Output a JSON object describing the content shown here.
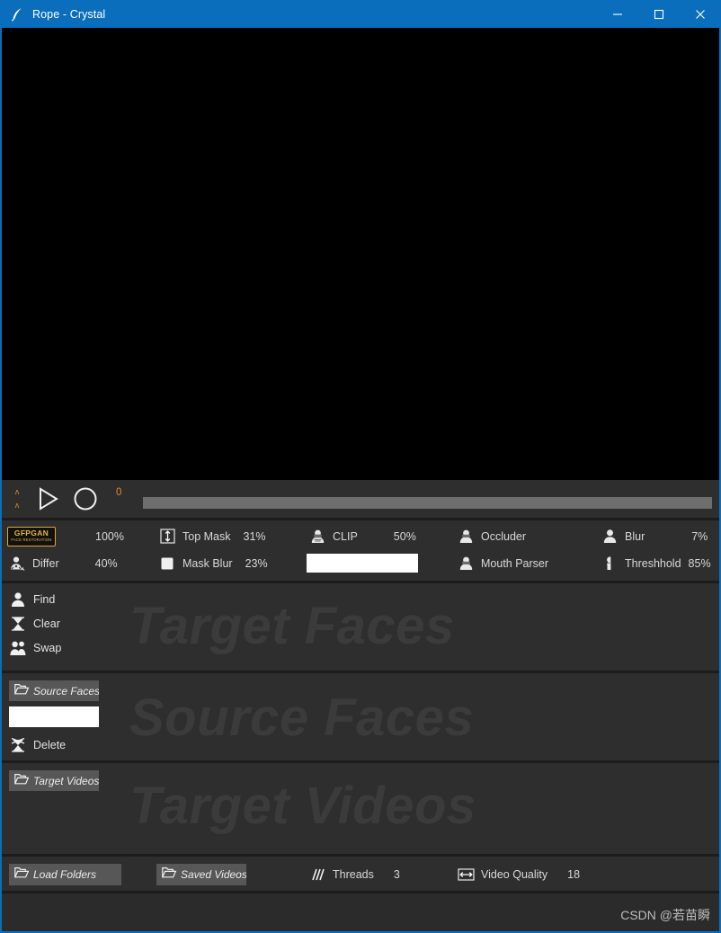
{
  "window": {
    "title": "Rope - Crystal",
    "app_icon": "feather-icon",
    "accent_color": "#0a6ebd",
    "controls": {
      "minimize": "minimize-button",
      "maximize": "maximize-button",
      "close": "close-button"
    }
  },
  "preview": {
    "name": "video-preview",
    "background": "#000000"
  },
  "playback": {
    "chevron_up_1": "ʌ",
    "chevron_up_2": "ʌ",
    "play_icon": "play-icon",
    "record_icon": "record-icon",
    "frame_number": "0",
    "frame_number_color": "#e08a2e",
    "timeline_name": "timeline-slider"
  },
  "settings": {
    "row1": [
      {
        "icon": "gfpgan-badge",
        "badge_top": "GFPGAN",
        "badge_bottom": "FACE RESTORATION",
        "label": "",
        "value": "100%"
      },
      {
        "icon": "vertical-arrows-icon",
        "label": "Top Mask",
        "value": "31%"
      },
      {
        "icon": "person-mask-icon",
        "label": "CLIP",
        "value": "50%"
      },
      {
        "icon": "person-icon",
        "label": "Occluder",
        "value": ""
      },
      {
        "icon": "person-icon",
        "label": "Blur",
        "value": "7%"
      }
    ],
    "row2": [
      {
        "icon": "differ-icon",
        "label": "Differ",
        "value": "40%"
      },
      {
        "icon": "square-icon",
        "label": "Mask Blur",
        "value": "23%"
      },
      {
        "icon": "text-input",
        "label": "",
        "value": ""
      },
      {
        "icon": "person-icon",
        "label": "Mouth Parser",
        "value": ""
      },
      {
        "icon": "half-person-icon",
        "label": "Threshhold",
        "value": "85%"
      }
    ],
    "clip_input_value": ""
  },
  "target_faces": {
    "ghost_label": "Target Faces",
    "actions": [
      {
        "icon": "person-icon",
        "label": "Find"
      },
      {
        "icon": "hourglass-icon",
        "label": "Clear"
      },
      {
        "icon": "two-people-icon",
        "label": "Swap"
      }
    ]
  },
  "source_faces": {
    "ghost_label": "Source Faces",
    "folder_button": {
      "icon": "folder-icon",
      "label": "Source Faces"
    },
    "filter_input_value": "",
    "actions": [
      {
        "icon": "crossed-hourglass-icon",
        "label": "Delete"
      }
    ]
  },
  "target_videos": {
    "ghost_label": "Target Videos",
    "folder_button": {
      "icon": "folder-icon",
      "label": "Target Videos"
    }
  },
  "bottom_bar": {
    "load_folders": {
      "icon": "folder-icon",
      "label": "Load Folders"
    },
    "saved_videos": {
      "icon": "folder-icon",
      "label": "Saved Videos"
    },
    "threads": {
      "icon": "threads-icon",
      "label": "Threads",
      "value": "3"
    },
    "video_quality": {
      "icon": "horizontal-arrows-icon",
      "label": "Video Quality",
      "value": "18"
    }
  },
  "watermark": {
    "text": "CSDN @若苗瞬"
  }
}
